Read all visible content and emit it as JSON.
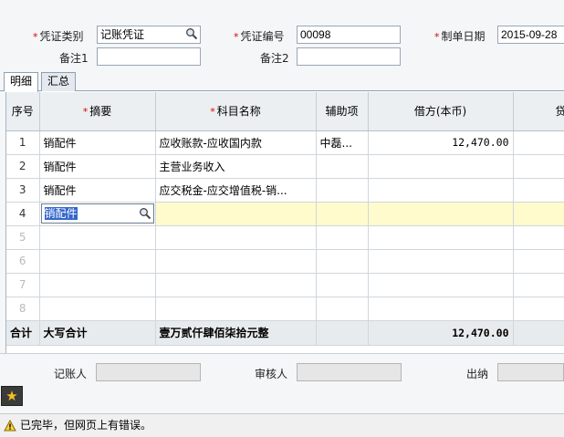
{
  "header": {
    "voucher_type_label": "凭证类别",
    "voucher_type_value": "记账凭证",
    "voucher_no_label": "凭证编号",
    "voucher_no_value": "00098",
    "date_label": "制单日期",
    "date_value": "2015-09-28",
    "remark1_label": "备注1",
    "remark1_value": "",
    "remark2_label": "备注2",
    "remark2_value": ""
  },
  "tabs": [
    {
      "label": "明细",
      "active": true
    },
    {
      "label": "汇总",
      "active": false
    }
  ],
  "grid": {
    "columns": [
      "序号",
      "摘要",
      "科目名称",
      "辅助项",
      "借方(本币)",
      "贷"
    ],
    "required_columns": [
      false,
      true,
      true,
      false,
      false,
      false
    ],
    "rows": [
      {
        "no": "1",
        "summary": "销配件",
        "account": "应收账款-应收国内款",
        "aux": "中磊...",
        "debit": "12,470.00",
        "credit": ""
      },
      {
        "no": "2",
        "summary": "销配件",
        "account": "主营业务收入",
        "aux": "",
        "debit": "",
        "credit": ""
      },
      {
        "no": "3",
        "summary": "销配件",
        "account": "应交税金-应交增值税-销...",
        "aux": "",
        "debit": "",
        "credit": ""
      },
      {
        "no": "4",
        "summary": "销配件",
        "account": "",
        "aux": "",
        "debit": "",
        "credit": ""
      },
      {
        "no": "5",
        "summary": "",
        "account": "",
        "aux": "",
        "debit": "",
        "credit": ""
      },
      {
        "no": "6",
        "summary": "",
        "account": "",
        "aux": "",
        "debit": "",
        "credit": ""
      },
      {
        "no": "7",
        "summary": "",
        "account": "",
        "aux": "",
        "debit": "",
        "credit": ""
      },
      {
        "no": "8",
        "summary": "",
        "account": "",
        "aux": "",
        "debit": "",
        "credit": ""
      }
    ],
    "total": {
      "label": "合计",
      "caps_label": "大写合计",
      "caps_value": "壹万贰仟肆佰柒拾元整",
      "debit": "12,470.00"
    }
  },
  "footer": {
    "bookkeeper_label": "记账人",
    "reviewer_label": "审核人",
    "cashier_label": "出纳"
  },
  "status": {
    "text": "已完毕，但网页上有错误。",
    "icon": "warning-icon"
  },
  "colors": {
    "required": "#e00000",
    "active_row": "#fffbcc",
    "selection": "#3366cc",
    "fav_star": "#f6c21b"
  }
}
